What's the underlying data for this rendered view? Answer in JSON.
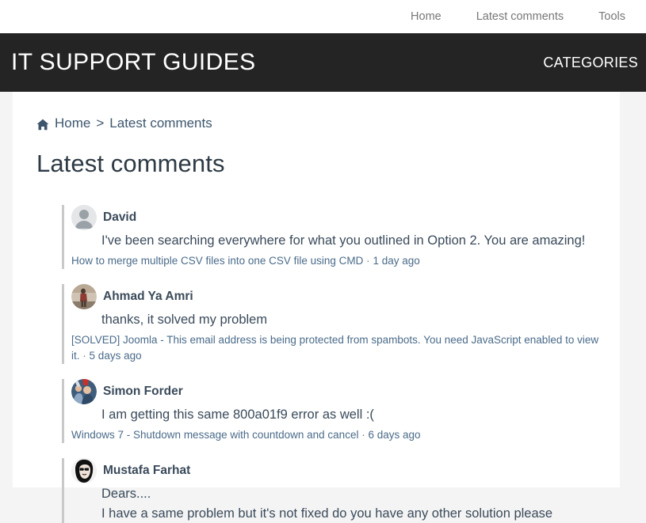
{
  "topnav": {
    "items": [
      {
        "label": "Home",
        "name": "topnav-item-home"
      },
      {
        "label": "Latest comments",
        "name": "topnav-item-latest-comments"
      },
      {
        "label": "Tools",
        "name": "topnav-item-tools"
      }
    ]
  },
  "header": {
    "brand": "IT SUPPORT GUIDES",
    "categories_label": "CATEGORIES",
    "background_color": "#242424",
    "text_color": "#ffffff"
  },
  "breadcrumb": {
    "home_label": "Home",
    "separator": ">",
    "current": "Latest comments",
    "home_icon": "home-icon"
  },
  "main": {
    "title": "Latest comments",
    "comments": [
      {
        "author": "David",
        "avatar_type": "default-placeholder",
        "body": "I've been searching everywhere for what you outlined in Option 2. You are amazing!",
        "extra_line": "",
        "post_title": "How to merge multiple CSV files into one CSV file using CMD",
        "separator": "·",
        "time": "1 day ago"
      },
      {
        "author": "Ahmad Ya Amri",
        "avatar_type": "photo-person-standing",
        "body": "thanks, it solved my problem",
        "extra_line": "",
        "post_title": "[SOLVED] Joomla - This email address is being protected from spambots. You need JavaScript enabled to view it.",
        "separator": "·",
        "time": "5 days ago"
      },
      {
        "author": "Simon Forder",
        "avatar_type": "photo-two-people",
        "body": "I am getting this same 800a01f9 error as well :(",
        "extra_line": "",
        "post_title": "Windows 7 - Shutdown message with countdown and cancel",
        "separator": "·",
        "time": "6 days ago"
      },
      {
        "author": "Mustafa Farhat",
        "avatar_type": "photo-portrait-bw",
        "body": "Dears....",
        "extra_line": "I have a same problem but it's not fixed do you have any other solution please",
        "post_title": "",
        "separator": "",
        "time": ""
      }
    ]
  },
  "colors": {
    "page_background": "#f4f4f4",
    "content_background": "#ffffff",
    "link": "#4a6b8a",
    "text": "#3a4a5a",
    "comment_border": "#c9c9c9"
  }
}
